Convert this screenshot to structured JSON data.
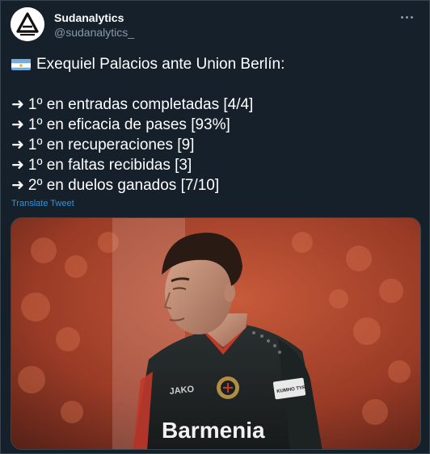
{
  "author": {
    "display_name": "Sudanalytics",
    "handle": "@sudanalytics_",
    "avatar_icon": "triangle-logo-icon"
  },
  "tweet": {
    "title_line": "Exequiel Palacios ante Union Berlín:",
    "flag_icon": "argentina-flag-icon",
    "arrow_glyph": "➜",
    "stats": [
      "1º en entradas completadas [4/4]",
      "1º en eficacia de pases [93%]",
      "1º en recuperaciones [9]",
      "1º en faltas recibidas [3]",
      "2º en duelos ganados [7/10]"
    ],
    "translate_label": "Translate Tweet"
  },
  "media": {
    "kit_sponsor": "Barmenia",
    "kit_brand": "JAKO",
    "sleeve_text": "KUMHO TYRE"
  },
  "colors": {
    "background": "#15202b",
    "border": "#38444d",
    "secondary_text": "#8b98a5",
    "link": "#1d9bf0"
  }
}
